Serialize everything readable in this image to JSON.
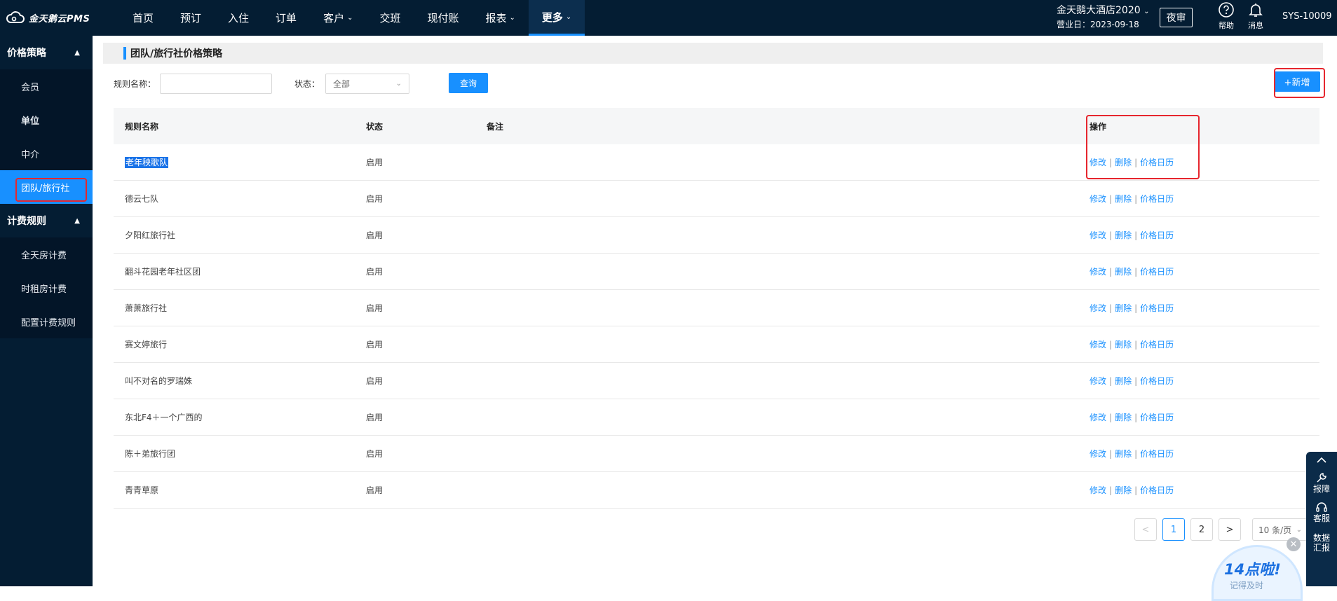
{
  "app": {
    "logo": "金天鹅云PMS"
  },
  "nav": [
    {
      "label": "首页",
      "chevron": false,
      "active": false
    },
    {
      "label": "预订",
      "chevron": false,
      "active": false
    },
    {
      "label": "入住",
      "chevron": false,
      "active": false
    },
    {
      "label": "订单",
      "chevron": false,
      "active": false
    },
    {
      "label": "客户",
      "chevron": true,
      "active": false
    },
    {
      "label": "交班",
      "chevron": false,
      "active": false
    },
    {
      "label": "现付账",
      "chevron": false,
      "active": false
    },
    {
      "label": "报表",
      "chevron": true,
      "active": false
    },
    {
      "label": "更多",
      "chevron": true,
      "active": true
    }
  ],
  "header": {
    "hotel_name": "金天鹅大酒店2020",
    "business_date": "营业日：2023-09-18",
    "night_audit": "夜审",
    "help": "帮助",
    "messages": "消息",
    "user": "SYS-10009"
  },
  "sidebar": {
    "groups": [
      {
        "label": "价格策略",
        "items": [
          "会员",
          "单位",
          "中介",
          "团队/旅行社"
        ]
      },
      {
        "label": "计费规则",
        "items": [
          "全天房计费",
          "时租房计费",
          "配置计费规则"
        ]
      }
    ],
    "active_item": "团队/旅行社"
  },
  "page": {
    "title": "团队/旅行社价格策略",
    "filter": {
      "name_label": "规则名称：",
      "name_value": "",
      "status_label": "状态：",
      "status_value": "全部",
      "query_button": "查询"
    },
    "add_button": "+新增"
  },
  "table": {
    "columns": [
      "规则名称",
      "状态",
      "备注",
      "操作"
    ],
    "rows": [
      {
        "name": "老年秧歌队",
        "status": "启用",
        "remark": ""
      },
      {
        "name": "德云七队",
        "status": "启用",
        "remark": ""
      },
      {
        "name": "夕阳红旅行社",
        "status": "启用",
        "remark": ""
      },
      {
        "name": "翻斗花园老年社区团",
        "status": "启用",
        "remark": ""
      },
      {
        "name": "萧萧旅行社",
        "status": "启用",
        "remark": ""
      },
      {
        "name": "赛文婷旅行",
        "status": "启用",
        "remark": ""
      },
      {
        "name": "叫不对名的罗瑞姝",
        "status": "启用",
        "remark": ""
      },
      {
        "name": "东北F4＋一个广西的",
        "status": "启用",
        "remark": ""
      },
      {
        "name": "陈＋弟旅行团",
        "status": "启用",
        "remark": ""
      },
      {
        "name": "青青草原",
        "status": "启用",
        "remark": ""
      }
    ],
    "ops": {
      "edit": "修改",
      "delete": "删除",
      "calendar": "价格日历",
      "separator": "|"
    }
  },
  "pagination": {
    "prev": "<",
    "pages": [
      "1",
      "2"
    ],
    "current": "1",
    "next": ">",
    "page_size": "10 条/页"
  },
  "float_bar": {
    "items": [
      "报障",
      "客服",
      "数据汇报"
    ]
  },
  "promo": {
    "text": "14点啦!",
    "sub": "记得及时"
  },
  "colors": {
    "primary": "#1890ff",
    "header_bg": "#041d33",
    "highlight_box": "#e6262e"
  }
}
